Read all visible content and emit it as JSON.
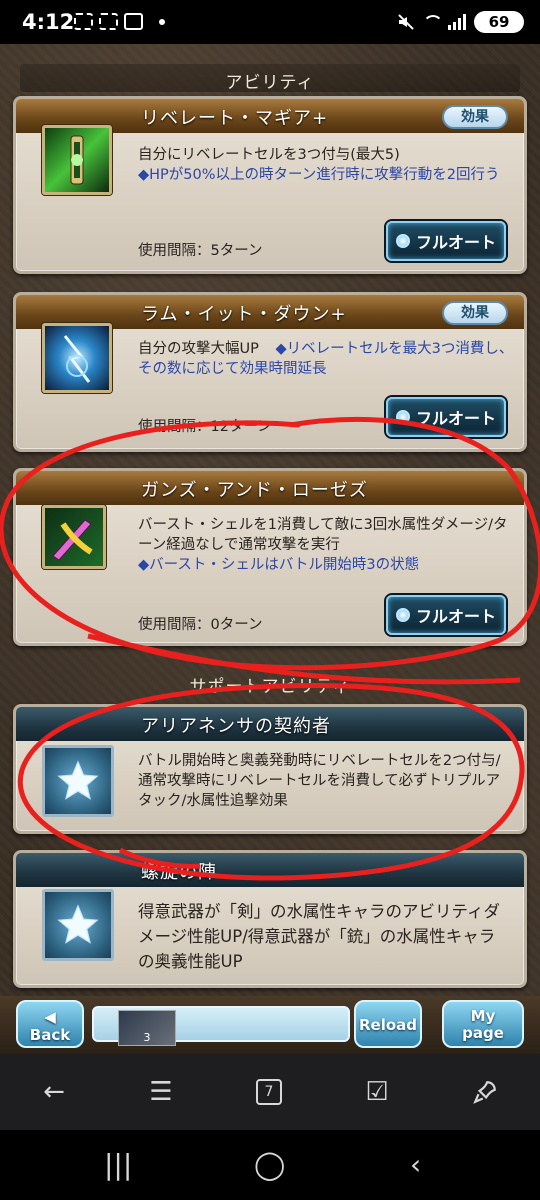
{
  "status_bar": {
    "time": "4:12",
    "battery": "69"
  },
  "sections": {
    "ability_title": "アビリティ",
    "support_title": "サポートアビリティ"
  },
  "abilities": [
    {
      "name": "リベレート・マギア+",
      "effect_label": "効果",
      "desc_black": "自分にリベレートセルを3つ付与(最大5)",
      "desc_blue": "◆HPが50%以上の時ターン進行時に攻撃行動を2回行う",
      "interval": "使用間隔：5ターン",
      "auto_label": "フルオート",
      "icon": "liberate-magia-icon"
    },
    {
      "name": "ラム・イット・ダウン+",
      "effect_label": "効果",
      "desc_black": "自分の攻撃大幅UP",
      "desc_blue": "◆リベレートセルを最大3つ消費し、その数に応じて効果時間延長",
      "interval": "使用間隔：12ターン",
      "auto_label": "フルオート",
      "icon": "ram-it-down-icon"
    },
    {
      "name": "ガンズ・アンド・ローゼズ",
      "desc_black": "バースト・シェルを1消費して敵に3回水属性ダメージ/ターン経過なしで通常攻撃を実行",
      "desc_blue": "◆バースト・シェルはバトル開始時3の状態",
      "interval": "使用間隔：0ターン",
      "auto_label": "フルオート",
      "icon": "guns-and-roses-icon"
    }
  ],
  "supports": [
    {
      "name": "アリアネンサの契約者",
      "desc": "バトル開始時と奥義発動時にリベレートセルを2つ付与/通常攻撃時にリベレートセルを消費して必ずトリプルアタック/水属性追撃効果"
    },
    {
      "name": "螺旋の陣",
      "desc": "得意武器が「剣」の水属性キャラのアビリティダメージ性能UP/得意武器が「銃」の水属性キャラの奥義性能UP"
    }
  ],
  "game_nav": {
    "back": "Back",
    "reload": "Reload",
    "mypage_line1": "My",
    "mypage_line2": "page",
    "mini_badge": "3"
  },
  "browser_bar": {
    "tabs_count": "7"
  },
  "colors": {
    "annotation": "#e8201e",
    "card_header_gold": "#6a4519",
    "card_header_blue": "#1f3441"
  }
}
